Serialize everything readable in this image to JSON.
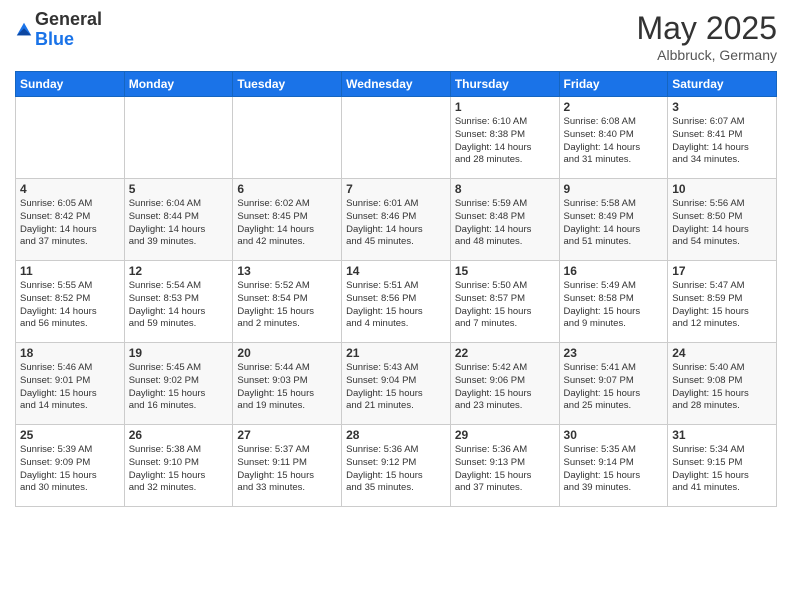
{
  "logo": {
    "general": "General",
    "blue": "Blue"
  },
  "title": "May 2025",
  "location": "Albbruck, Germany",
  "days_of_week": [
    "Sunday",
    "Monday",
    "Tuesday",
    "Wednesday",
    "Thursday",
    "Friday",
    "Saturday"
  ],
  "weeks": [
    [
      {
        "day": "",
        "info": ""
      },
      {
        "day": "",
        "info": ""
      },
      {
        "day": "",
        "info": ""
      },
      {
        "day": "",
        "info": ""
      },
      {
        "day": "1",
        "info": "Sunrise: 6:10 AM\nSunset: 8:38 PM\nDaylight: 14 hours\nand 28 minutes."
      },
      {
        "day": "2",
        "info": "Sunrise: 6:08 AM\nSunset: 8:40 PM\nDaylight: 14 hours\nand 31 minutes."
      },
      {
        "day": "3",
        "info": "Sunrise: 6:07 AM\nSunset: 8:41 PM\nDaylight: 14 hours\nand 34 minutes."
      }
    ],
    [
      {
        "day": "4",
        "info": "Sunrise: 6:05 AM\nSunset: 8:42 PM\nDaylight: 14 hours\nand 37 minutes."
      },
      {
        "day": "5",
        "info": "Sunrise: 6:04 AM\nSunset: 8:44 PM\nDaylight: 14 hours\nand 39 minutes."
      },
      {
        "day": "6",
        "info": "Sunrise: 6:02 AM\nSunset: 8:45 PM\nDaylight: 14 hours\nand 42 minutes."
      },
      {
        "day": "7",
        "info": "Sunrise: 6:01 AM\nSunset: 8:46 PM\nDaylight: 14 hours\nand 45 minutes."
      },
      {
        "day": "8",
        "info": "Sunrise: 5:59 AM\nSunset: 8:48 PM\nDaylight: 14 hours\nand 48 minutes."
      },
      {
        "day": "9",
        "info": "Sunrise: 5:58 AM\nSunset: 8:49 PM\nDaylight: 14 hours\nand 51 minutes."
      },
      {
        "day": "10",
        "info": "Sunrise: 5:56 AM\nSunset: 8:50 PM\nDaylight: 14 hours\nand 54 minutes."
      }
    ],
    [
      {
        "day": "11",
        "info": "Sunrise: 5:55 AM\nSunset: 8:52 PM\nDaylight: 14 hours\nand 56 minutes."
      },
      {
        "day": "12",
        "info": "Sunrise: 5:54 AM\nSunset: 8:53 PM\nDaylight: 14 hours\nand 59 minutes."
      },
      {
        "day": "13",
        "info": "Sunrise: 5:52 AM\nSunset: 8:54 PM\nDaylight: 15 hours\nand 2 minutes."
      },
      {
        "day": "14",
        "info": "Sunrise: 5:51 AM\nSunset: 8:56 PM\nDaylight: 15 hours\nand 4 minutes."
      },
      {
        "day": "15",
        "info": "Sunrise: 5:50 AM\nSunset: 8:57 PM\nDaylight: 15 hours\nand 7 minutes."
      },
      {
        "day": "16",
        "info": "Sunrise: 5:49 AM\nSunset: 8:58 PM\nDaylight: 15 hours\nand 9 minutes."
      },
      {
        "day": "17",
        "info": "Sunrise: 5:47 AM\nSunset: 8:59 PM\nDaylight: 15 hours\nand 12 minutes."
      }
    ],
    [
      {
        "day": "18",
        "info": "Sunrise: 5:46 AM\nSunset: 9:01 PM\nDaylight: 15 hours\nand 14 minutes."
      },
      {
        "day": "19",
        "info": "Sunrise: 5:45 AM\nSunset: 9:02 PM\nDaylight: 15 hours\nand 16 minutes."
      },
      {
        "day": "20",
        "info": "Sunrise: 5:44 AM\nSunset: 9:03 PM\nDaylight: 15 hours\nand 19 minutes."
      },
      {
        "day": "21",
        "info": "Sunrise: 5:43 AM\nSunset: 9:04 PM\nDaylight: 15 hours\nand 21 minutes."
      },
      {
        "day": "22",
        "info": "Sunrise: 5:42 AM\nSunset: 9:06 PM\nDaylight: 15 hours\nand 23 minutes."
      },
      {
        "day": "23",
        "info": "Sunrise: 5:41 AM\nSunset: 9:07 PM\nDaylight: 15 hours\nand 25 minutes."
      },
      {
        "day": "24",
        "info": "Sunrise: 5:40 AM\nSunset: 9:08 PM\nDaylight: 15 hours\nand 28 minutes."
      }
    ],
    [
      {
        "day": "25",
        "info": "Sunrise: 5:39 AM\nSunset: 9:09 PM\nDaylight: 15 hours\nand 30 minutes."
      },
      {
        "day": "26",
        "info": "Sunrise: 5:38 AM\nSunset: 9:10 PM\nDaylight: 15 hours\nand 32 minutes."
      },
      {
        "day": "27",
        "info": "Sunrise: 5:37 AM\nSunset: 9:11 PM\nDaylight: 15 hours\nand 33 minutes."
      },
      {
        "day": "28",
        "info": "Sunrise: 5:36 AM\nSunset: 9:12 PM\nDaylight: 15 hours\nand 35 minutes."
      },
      {
        "day": "29",
        "info": "Sunrise: 5:36 AM\nSunset: 9:13 PM\nDaylight: 15 hours\nand 37 minutes."
      },
      {
        "day": "30",
        "info": "Sunrise: 5:35 AM\nSunset: 9:14 PM\nDaylight: 15 hours\nand 39 minutes."
      },
      {
        "day": "31",
        "info": "Sunrise: 5:34 AM\nSunset: 9:15 PM\nDaylight: 15 hours\nand 41 minutes."
      }
    ]
  ]
}
